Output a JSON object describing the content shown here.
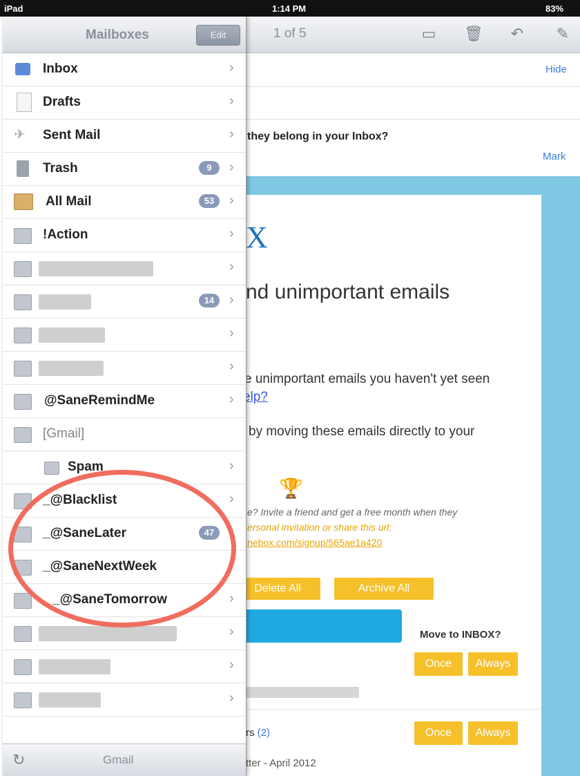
{
  "status": {
    "device": "iPad",
    "time": "1:14 PM",
    "battery": "83%"
  },
  "toolbar": {
    "counter": "1 of 5",
    "icons": [
      "folder-icon",
      "trash-icon",
      "reply-icon",
      "compose-icon"
    ]
  },
  "message": {
    "hide": "Hide",
    "mark": "Mark",
    "question": "they belong in your Inbox?",
    "logo_fragment": "X",
    "headline": "nd unimportant emails",
    "para1": "e unimportant emails you haven't yet seen",
    "para1_link": "elp?",
    "para2": "by moving these emails directly to your",
    "invite1": "e? Invite a friend and get a free month when they",
    "invite2": "ersonal invitation or share this url:",
    "invite3": "nebox.com/signup/565ae1a420",
    "delete_all": "Delete All",
    "archive_all": "Archive All",
    "move_to_inbox": "Move to INBOX?",
    "once": "Once",
    "always": "Always",
    "row1_prefix": "rs",
    "row1_count": "(2)",
    "row2": "tter - April 2012"
  },
  "mailboxes": {
    "title": "Mailboxes",
    "edit": "Edit",
    "footer_label": "Gmail",
    "items": [
      {
        "label": "Inbox"
      },
      {
        "label": "Drafts"
      },
      {
        "label": "Sent Mail"
      },
      {
        "label": "Trash",
        "badge": "9"
      },
      {
        "label": "All Mail",
        "badge": "53"
      },
      {
        "label": "!Action"
      },
      {
        "label": ""
      },
      {
        "label": "",
        "badge": "14"
      },
      {
        "label": ""
      },
      {
        "label": ""
      },
      {
        "label": "@SaneRemindMe"
      },
      {
        "label": "[Gmail]"
      },
      {
        "label": "Spam"
      },
      {
        "label": "_@Blacklist"
      },
      {
        "label": "_@SaneLater",
        "badge": "47"
      },
      {
        "label": "_@SaneNextWeek"
      },
      {
        "label": "_@SaneTomorrow"
      },
      {
        "label": ""
      },
      {
        "label": ""
      },
      {
        "label": ""
      }
    ]
  },
  "colors": {
    "highlight_circle": "#f06d5e",
    "accent_yellow": "#f6c02b",
    "link_blue": "#3b7de0"
  }
}
